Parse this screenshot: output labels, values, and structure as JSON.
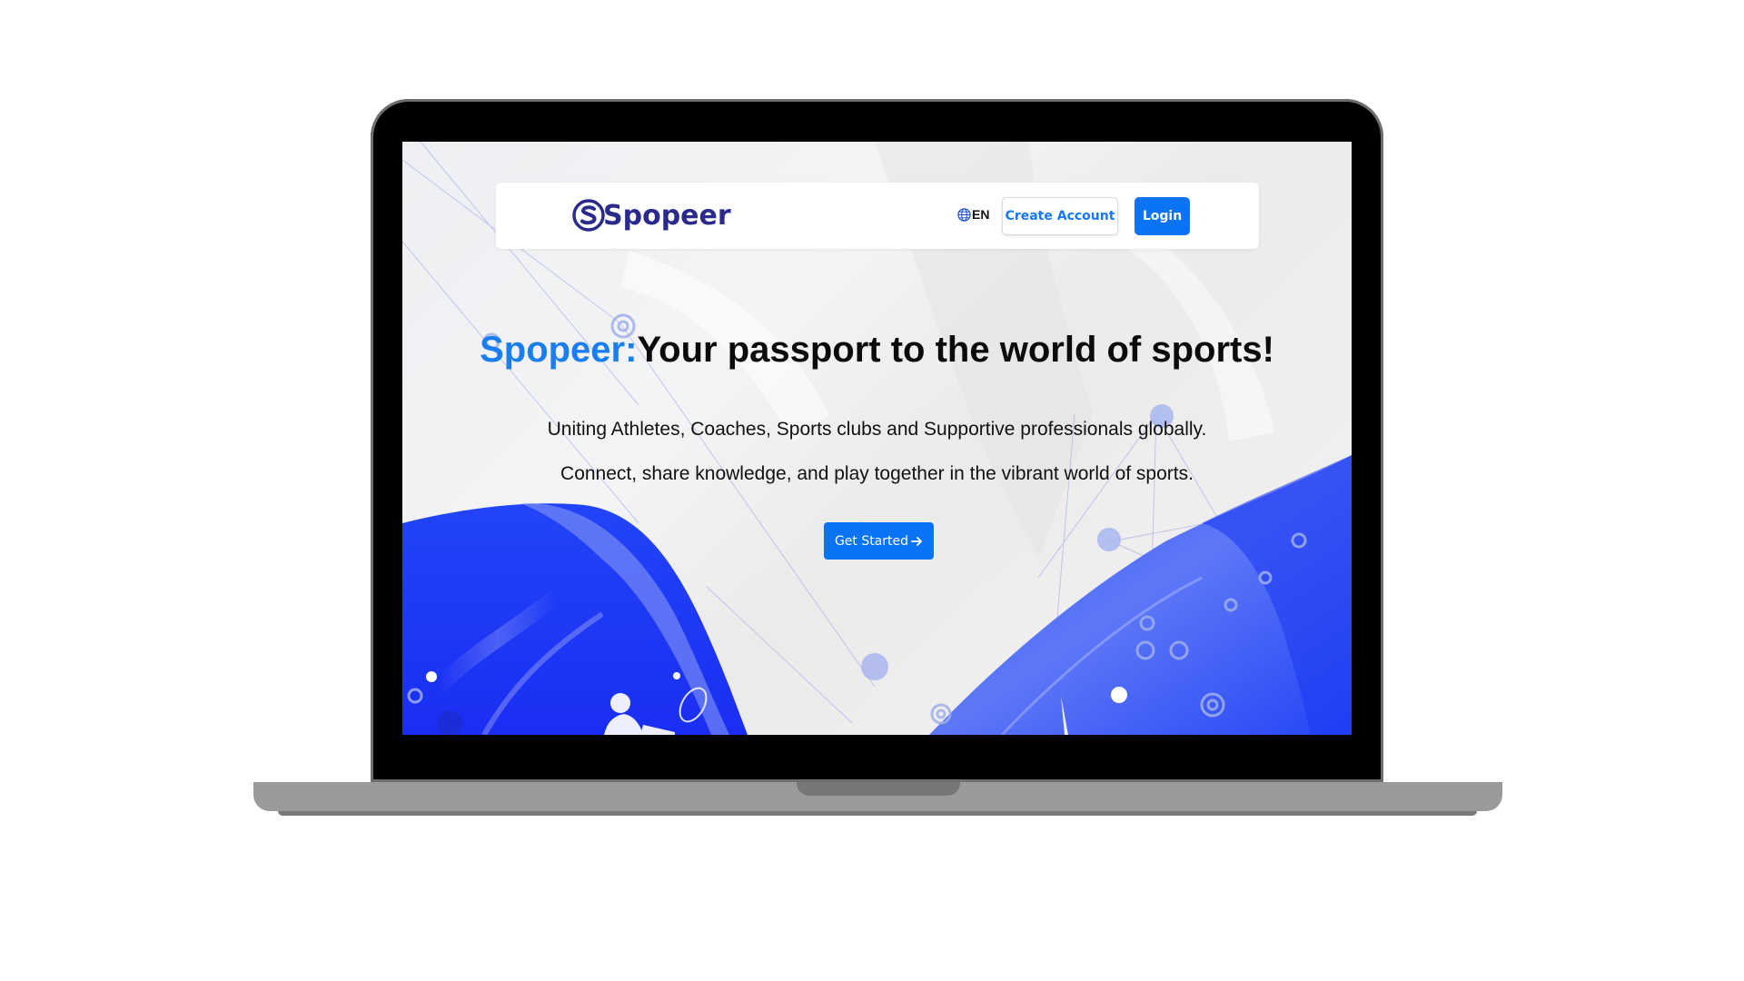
{
  "brand": {
    "name": "Spopeer",
    "logo_icon": "spopeer-s-logo-icon",
    "color": "#2a2a8c"
  },
  "nav": {
    "language": "EN",
    "language_icon": "globe-icon",
    "create_account_label": "Create Account",
    "login_label": "Login"
  },
  "hero": {
    "title_accent": "Spopeer:",
    "title_rest": "Your passport to the world of sports!",
    "subtitle_1": "Uniting Athletes, Coaches, Sports clubs and Supportive professionals globally.",
    "subtitle_2": "Connect, share knowledge, and play together in the vibrant world of sports.",
    "cta_label": "Get Started",
    "cta_icon": "arrow-right-icon"
  },
  "colors": {
    "accent": "#1a7ef0",
    "button_primary": "#0a74f5",
    "wave_blue": "#1f3cf5"
  }
}
